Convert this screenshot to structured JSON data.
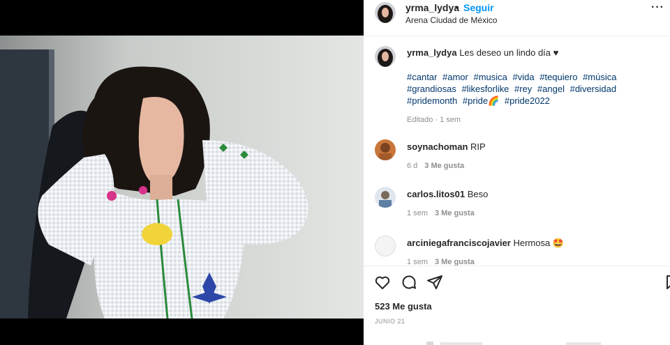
{
  "post": {
    "username": "yrma_lydya",
    "separator": "•",
    "follow_label": "Seguir",
    "location": "Arena Ciudad de México",
    "more_icon": "more-options-icon",
    "more_label": "···"
  },
  "caption": {
    "username": "yrma_lydya",
    "text": "Les deseo un lindo día ♥",
    "hashtags": [
      "#cantar",
      "#amor",
      "#musica",
      "#vida",
      "#tequiero",
      "#música",
      "#grandiosas",
      "#likesforlike",
      "#rey",
      "#angel",
      "#diversidad",
      "#pridemonth",
      "#pride🌈",
      "#pride2022"
    ],
    "meta": "Editado · 1 sem"
  },
  "comments": [
    {
      "username": "soynachoman",
      "text": "RIP",
      "time": "6 d",
      "likes": "3 Me gusta",
      "avatar_color": "#c9763a"
    },
    {
      "username": "carlos.litos01",
      "text": "Beso",
      "time": "1 sem",
      "likes": "3 Me gusta",
      "avatar_color": "#8aa0b8"
    },
    {
      "username": "arciniegafranciscojavier",
      "text": "Hermosa 🤩",
      "time": "1 sem",
      "likes": "3 Me gusta",
      "avatar_color": "#f2f2f2"
    }
  ],
  "actions": {
    "like_icon": "heart-icon",
    "comment_icon": "comment-icon",
    "share_icon": "share-icon",
    "save_icon": "bookmark-icon"
  },
  "likes_count": "523 Me gusta",
  "date": "JUNIO 21",
  "colors": {
    "link": "#0095f6",
    "hashtag": "#00376b",
    "muted": "#8e8e8e",
    "text": "#262626"
  }
}
